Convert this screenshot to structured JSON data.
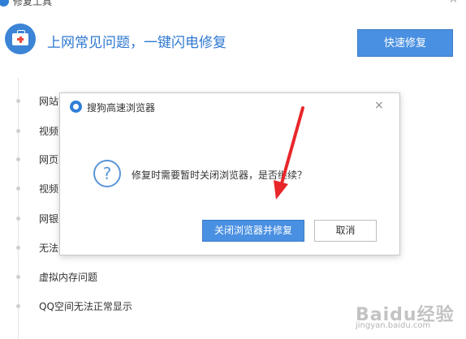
{
  "window": {
    "title": "修复工具",
    "close_glyph": "×"
  },
  "header": {
    "title": "上网常见问题，一键闪电修复",
    "quick_fix_label": "快速修复",
    "icon": "first-aid-kit-icon",
    "accent_color": "#2e78d0"
  },
  "issues": [
    {
      "label": "网站"
    },
    {
      "label": "视频"
    },
    {
      "label": "网页"
    },
    {
      "label": "视频"
    },
    {
      "label": "网银"
    },
    {
      "label": "无法"
    },
    {
      "label": "虚拟内存问题"
    },
    {
      "label": "QQ空间无法正常显示"
    }
  ],
  "dialog": {
    "title": "搜狗高速浏览器",
    "close_glyph": "×",
    "icon": "question-icon",
    "question_glyph": "?",
    "message": "修复时需要暂时关闭浏览器，是否继续？",
    "confirm_label": "关闭浏览器并修复",
    "cancel_label": "取消"
  },
  "annotation": {
    "icon": "red-arrow-icon",
    "color": "#e8262a"
  },
  "watermark": {
    "logo_text": "Baidu经验",
    "sub_text": "jingyan.baidu.com"
  }
}
